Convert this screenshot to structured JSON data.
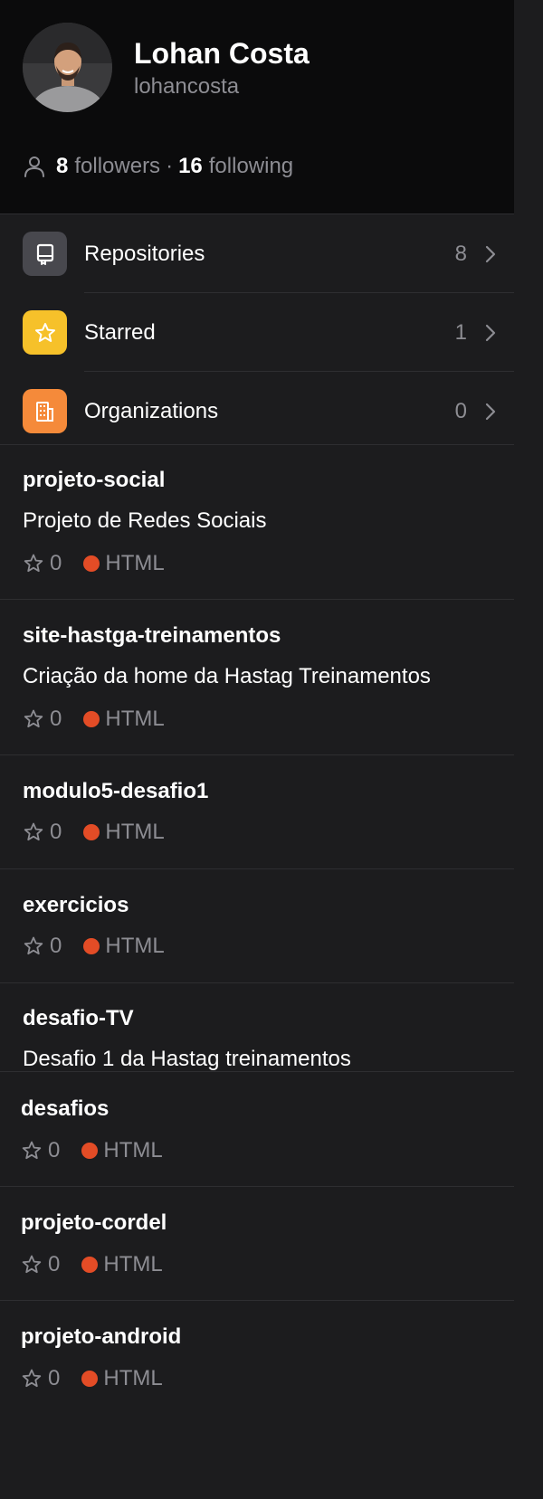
{
  "profile": {
    "name": "Lohan Costa",
    "username": "lohancosta",
    "followers_count": "8",
    "followers_label": "followers",
    "separator": "·",
    "following_count": "16",
    "following_label": "following"
  },
  "menu": [
    {
      "label": "Repositories",
      "count": "8",
      "icon": "repo-icon",
      "color": "#48484e"
    },
    {
      "label": "Starred",
      "count": "1",
      "icon": "star-icon",
      "color": "#f6c12a"
    },
    {
      "label": "Organizations",
      "count": "0",
      "icon": "building-icon",
      "color": "#f58a3a"
    }
  ],
  "repos": [
    {
      "name": "projeto-social",
      "description": "Projeto de Redes Sociais",
      "stars": "0",
      "language": "HTML"
    },
    {
      "name": "site-hastga-treinamentos",
      "description": "Criação da home da Hastag Treinamentos",
      "stars": "0",
      "language": "HTML"
    },
    {
      "name": "modulo5-desafio1",
      "stars": "0",
      "language": "HTML"
    },
    {
      "name": "exercicios",
      "stars": "0",
      "language": "HTML"
    },
    {
      "name": "desafio-TV",
      "description": "Desafio 1 da Hastag treinamentos"
    },
    {
      "name": "desafios",
      "stars": "0",
      "language": "HTML"
    },
    {
      "name": "projeto-cordel",
      "stars": "0",
      "language": "HTML"
    },
    {
      "name": "projeto-android",
      "stars": "0",
      "language": "HTML"
    }
  ],
  "colors": {
    "html_language": "#e34c26",
    "background": "#1c1c1e",
    "header_background": "#0b0b0c",
    "secondary_text": "#8d8d93"
  }
}
